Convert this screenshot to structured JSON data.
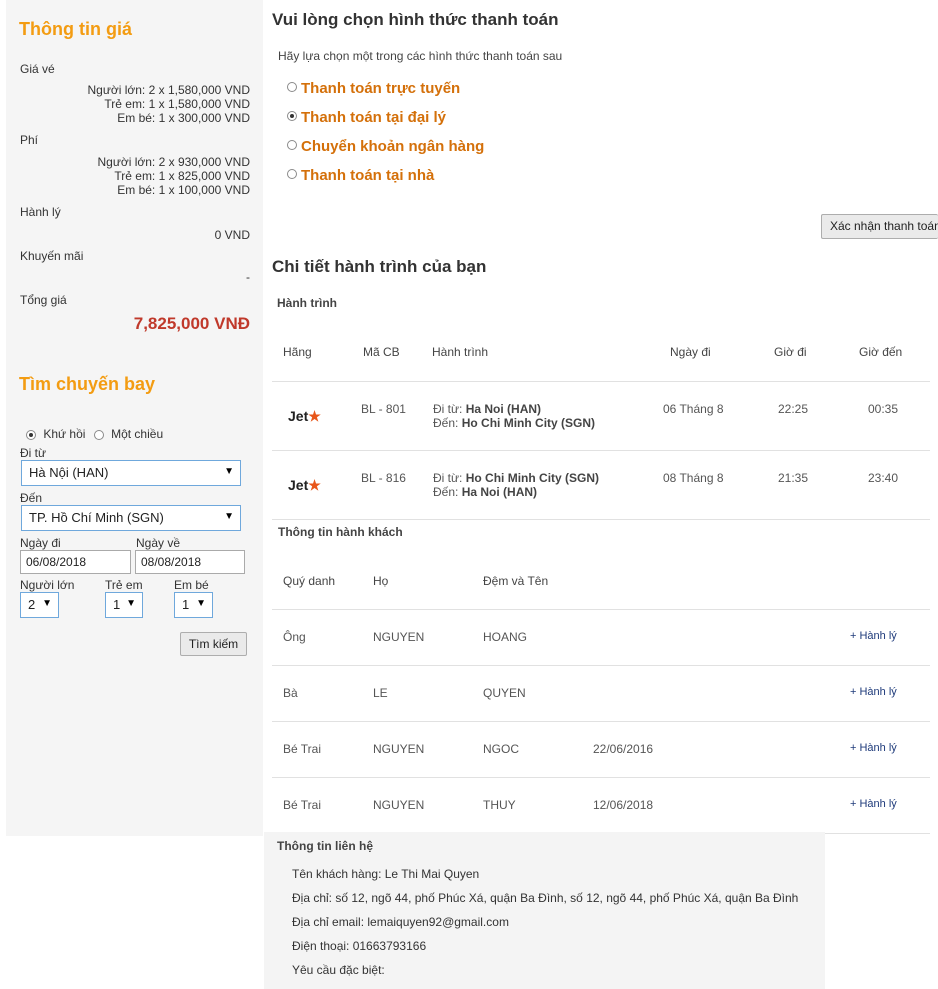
{
  "price": {
    "title": "Thông tin giá",
    "fare_label": "Giá vé",
    "fare_lines": [
      "Người lớn: 2 x 1,580,000 VND",
      "Trẻ em: 1 x 1,580,000 VND",
      "Em bé: 1 x 300,000 VND"
    ],
    "fee_label": "Phí",
    "fee_lines": [
      "Người lớn: 2 x 930,000 VND",
      "Trẻ em: 1 x 825,000 VND",
      "Em bé: 1 x 100,000 VND"
    ],
    "baggage_label": "Hành lý",
    "baggage_value": "0 VND",
    "promo_label": "Khuyến mãi",
    "promo_value": "-",
    "total_label": "Tổng giá",
    "total_value": "7,825,000 VNĐ"
  },
  "search": {
    "title": "Tìm chuyến bay",
    "round_trip": "Khứ hồi",
    "one_way": "Một chiều",
    "from_label": "Đi từ",
    "from_value": "Hà Nội (HAN)",
    "to_label": "Đến",
    "to_value": "TP. Hồ Chí Minh (SGN)",
    "depart_label": "Ngày đi",
    "depart_value": "06/08/2018",
    "return_label": "Ngày về",
    "return_value": "08/08/2018",
    "adult_label": "Người lớn",
    "adult_value": "2",
    "child_label": "Trẻ em",
    "child_value": "1",
    "infant_label": "Em bé",
    "infant_value": "1",
    "button": "Tìm kiếm"
  },
  "payment": {
    "title": "Vui lòng chọn hình thức thanh toán",
    "subtitle": "Hãy lựa chọn một trong các hình thức thanh toán sau",
    "options": [
      "Thanh toán trực tuyến",
      "Thanh toán tại đại lý",
      "Chuyển khoản ngân hàng",
      "Thanh toán tại nhà"
    ],
    "confirm_button": "Xác nhận thanh toán"
  },
  "itinerary": {
    "title": "Chi tiết hành trình của bạn",
    "section": "Hành trình",
    "headers": [
      "Hãng",
      "Mã CB",
      "Hành trình",
      "Ngày đi",
      "Giờ đi",
      "Giờ đến"
    ],
    "logo_text": "Jet",
    "logo_star": "★",
    "from_prefix": "Đi từ:",
    "to_prefix": "Đến:",
    "flights": [
      {
        "code": "BL - 801",
        "from": "Ha Noi (HAN)",
        "to": "Ho Chi Minh City (SGN)",
        "date": "06 Tháng 8",
        "dep": "22:25",
        "arr": "00:35"
      },
      {
        "code": "BL - 816",
        "from": "Ho Chi Minh City (SGN)",
        "to": "Ha Noi (HAN)",
        "date": "08 Tháng 8",
        "dep": "21:35",
        "arr": "23:40"
      }
    ]
  },
  "passengers": {
    "section": "Thông tin hành khách",
    "headers": [
      "Quý danh",
      "Họ",
      "Đệm và Tên"
    ],
    "baggage_link": "+ Hành lý",
    "rows": [
      {
        "title": "Ông",
        "last": "NGUYEN",
        "first": "HOANG",
        "dob": ""
      },
      {
        "title": "Bà",
        "last": "LE",
        "first": "QUYEN",
        "dob": ""
      },
      {
        "title": "Bé Trai",
        "last": "NGUYEN",
        "first": "NGOC",
        "dob": "22/06/2016"
      },
      {
        "title": "Bé Trai",
        "last": "NGUYEN",
        "first": "THUY",
        "dob": "12/06/2018"
      }
    ]
  },
  "contact": {
    "section": "Thông tin liên hệ",
    "name": "Tên khách hàng: Le Thi Mai Quyen",
    "address": "Địa chỉ: số 12, ngõ 44, phố Phúc Xá, quận Ba Đình, số 12, ngõ 44, phố Phúc Xá, quận Ba Đình",
    "email": "Địa chỉ email: lemaiquyen92@gmail.com",
    "phone": "Điện thoại: 01663793166",
    "special": "Yêu cầu đặc biệt:"
  }
}
